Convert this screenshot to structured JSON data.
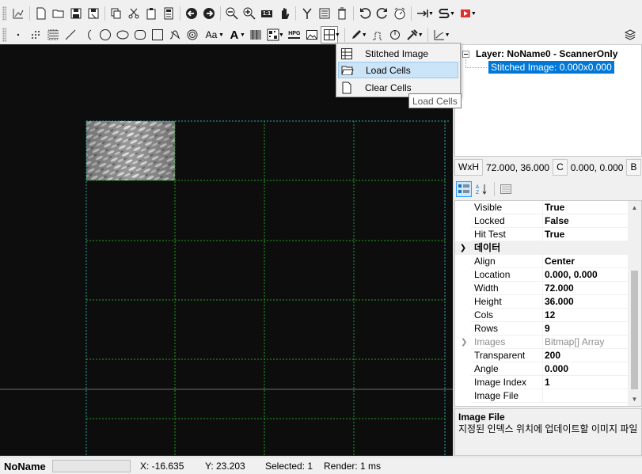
{
  "toolbar_row1": {
    "icons": [
      "chart-axis-icon",
      "new-file-icon",
      "open-folder-icon",
      "save-icon",
      "save-as-icon",
      "copy-icon",
      "cut-icon",
      "paste-icon",
      "calculator-icon",
      "undo-arrow-icon",
      "redo-arrow-icon",
      "zoom-out-icon",
      "zoom-in-icon",
      "zoom-1to1-icon",
      "pan-hand-icon",
      "fork-icon",
      "list-icon",
      "trash-icon",
      "rotate-ccw-icon",
      "rotate-cw-icon",
      "timer-icon",
      "step-icon",
      "scanner-icon",
      "record-icon"
    ],
    "zoom_1to1_label": "1:1"
  },
  "toolbar_row2": {
    "icons": [
      "point-icon",
      "dot-matrix-icon",
      "hatch-icon",
      "line-icon",
      "arc-icon",
      "circle-icon",
      "ellipse-icon",
      "rounded-rect-icon",
      "rectangle-icon",
      "curve-icon",
      "spiral-icon",
      "text-font-icon",
      "text-bold-icon",
      "barcode-icon",
      "qrcode-icon",
      "hpgl-icon",
      "image-icon",
      "grid-cells-icon",
      "pen-icon",
      "jump-icon",
      "rotary-icon",
      "laser-icon",
      "plot-icon",
      "layers-icon"
    ],
    "text_font_label": "Aa",
    "text_bold_label": "A",
    "hpgl_label": "HPG"
  },
  "menu": {
    "items": [
      {
        "label": "Stitched Image",
        "icon": "table-grid-icon"
      },
      {
        "label": "Load Cells",
        "icon": "folder-open-icon"
      },
      {
        "label": "Clear Cells",
        "icon": "blank-page-icon"
      }
    ],
    "tooltip": "Load Cells"
  },
  "tree": {
    "layer_label": "Layer: NoName0 - ScannerOnly",
    "child_label": "Stitched Image: 0.000x0.000"
  },
  "size_bar": {
    "wh_label": "WxH",
    "wh_value": "72.000, 36.000",
    "c_label": "C",
    "c_value": "0.000, 0.000",
    "b_label": "B"
  },
  "properties": [
    {
      "name": "Visible",
      "value": "True"
    },
    {
      "name": "Locked",
      "value": "False"
    },
    {
      "name": "Hit Test",
      "value": "True"
    },
    {
      "category": "데이터"
    },
    {
      "name": "Align",
      "value": "Center"
    },
    {
      "name": "Location",
      "value": "0.000, 0.000"
    },
    {
      "name": "Width",
      "value": "72.000"
    },
    {
      "name": "Height",
      "value": "36.000"
    },
    {
      "name": "Cols",
      "value": "12"
    },
    {
      "name": "Rows",
      "value": "9"
    },
    {
      "name": "Images",
      "value": "Bitmap[] Array",
      "disabled": true
    },
    {
      "name": "Transparent",
      "value": "200"
    },
    {
      "name": "Angle",
      "value": "0.000"
    },
    {
      "name": "Image Index",
      "value": "1"
    },
    {
      "name": "Image File",
      "value": ""
    }
  ],
  "description": {
    "title": "Image File",
    "text": "지정된 인덱스 위치에 업데이트할 이미지 파일"
  },
  "status": {
    "document_name": "NoName",
    "x": "X: -16.635",
    "y": "Y: 23.203",
    "selected": "Selected: 1",
    "render": "Render: 1 ms"
  },
  "colors": {
    "canvas_bg": "#0d0d0d",
    "grid_line": "#1fa31f",
    "selection_bg": "#0078d7",
    "menu_hover": "#cce4f7"
  }
}
